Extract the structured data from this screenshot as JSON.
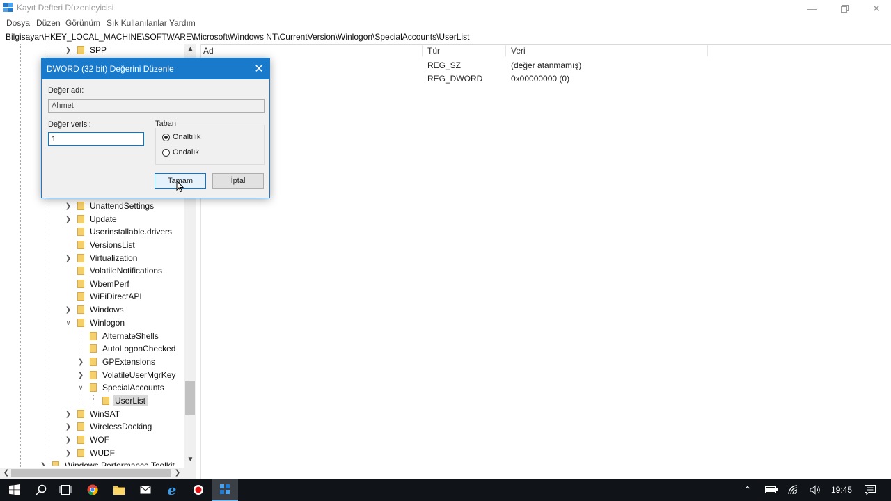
{
  "window": {
    "title": "Kayıt Defteri Düzenleyicisi",
    "controls": [
      "minimize-icon",
      "restore-icon",
      "close-icon"
    ]
  },
  "menu": [
    "Dosya",
    "Düzen",
    "Görünüm",
    "Sık Kullanılanlar",
    "Yardım"
  ],
  "address": "Bilgisayar\\HKEY_LOCAL_MACHINE\\SOFTWARE\\Microsoft\\Windows NT\\CurrentVersion\\Winlogon\\SpecialAccounts\\UserList",
  "tree": {
    "items": [
      {
        "label": "SPP",
        "chevron": "right"
      },
      {
        "label": "UnattendSettings",
        "chevron": "right"
      },
      {
        "label": "Update",
        "chevron": "right"
      },
      {
        "label": "Userinstallable.drivers",
        "chevron": ""
      },
      {
        "label": "VersionsList",
        "chevron": ""
      },
      {
        "label": "Virtualization",
        "chevron": "right"
      },
      {
        "label": "VolatileNotifications",
        "chevron": ""
      },
      {
        "label": "WbemPerf",
        "chevron": ""
      },
      {
        "label": "WiFiDirectAPI",
        "chevron": ""
      },
      {
        "label": "Windows",
        "chevron": "right"
      },
      {
        "label": "Winlogon",
        "chevron": "down"
      },
      {
        "label": "AlternateShells",
        "chevron": ""
      },
      {
        "label": "AutoLogonChecked",
        "chevron": ""
      },
      {
        "label": "GPExtensions",
        "chevron": "right"
      },
      {
        "label": "VolatileUserMgrKey",
        "chevron": "right"
      },
      {
        "label": "SpecialAccounts",
        "chevron": "down"
      },
      {
        "label": "UserList",
        "chevron": "",
        "selected": true
      },
      {
        "label": "WinSAT",
        "chevron": "right"
      },
      {
        "label": "WirelessDocking",
        "chevron": "right"
      },
      {
        "label": "WOF",
        "chevron": "right"
      },
      {
        "label": "WUDF",
        "chevron": "right"
      },
      {
        "label": "Windows Performance Toolkit",
        "chevron": "right"
      }
    ]
  },
  "list": {
    "columns": [
      "Ad",
      "Tür",
      "Veri"
    ],
    "rows": [
      {
        "name": "",
        "type": "REG_SZ",
        "data": "(değer atanmamış)"
      },
      {
        "name": "",
        "type": "REG_DWORD",
        "data": "0x00000000 (0)"
      }
    ]
  },
  "dialog": {
    "title": "DWORD (32 bit) Değerini Düzenle",
    "name_label": "Değer adı:",
    "name_value": "Ahmet",
    "data_label": "Değer verisi:",
    "data_value": "1",
    "base_label": "Taban",
    "radio_hex": "Onaltılık",
    "radio_dec": "Ondalık",
    "selected_base": "Onaltılık",
    "ok_label": "Tamam",
    "cancel_label": "İptal"
  },
  "taskbar": {
    "clock": "19:45",
    "apps": [
      "windows-start-icon",
      "search-icon",
      "task-view-icon",
      "chrome-icon",
      "file-explorer-icon",
      "mail-icon",
      "edge-icon",
      "record-icon",
      "regedit-icon"
    ]
  },
  "colors": {
    "dialog_title_bg": "#1979ca",
    "taskbar_bg": "#101318",
    "selection_bg": "#d9d9d9",
    "folder": "#f5cf6a"
  }
}
